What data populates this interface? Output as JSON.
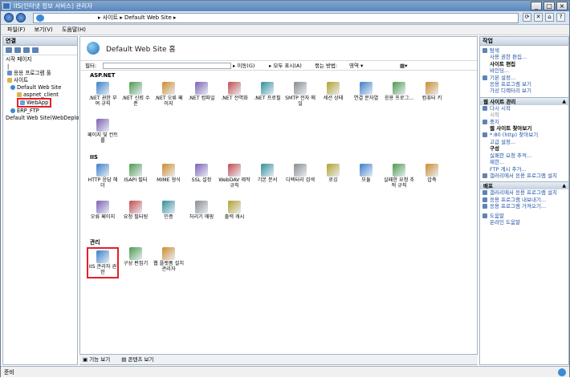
{
  "window": {
    "title": "IIS(인터넷 정보 서비스) 관리자"
  },
  "address": {
    "path": "▸ 사이트 ▸ Default Web Site ▸"
  },
  "menu": [
    "파일(F)",
    "보기(V)",
    "도움말(H)"
  ],
  "connections": {
    "header": "연결",
    "tree": [
      "시작 페이지",
      "|",
      "응용 프로그램 풀",
      "사이트",
      "Default Web Site",
      "aspnet_client",
      "WebApp",
      "ERP_FTP",
      "Default Web Site(WebDeploy)"
    ]
  },
  "center": {
    "title": "Default Web Site 홈",
    "filter": {
      "label": "필터:",
      "go": "이동(G)",
      "show_all": "모두 표시(A)",
      "groupby": "묶는 방법:",
      "groupby_value": "영역"
    },
    "groups": {
      "aspnet": {
        "label": "ASP.NET",
        "items": [
          ".NET 권한 부여 규칙",
          ".NET 신뢰 수준",
          ".NET 오류 페이지",
          ".NET 컴파일",
          ".NET 전역화",
          ".NET 프로필",
          "SMTP 전자 메일",
          "세션 상태",
          "연결 문자열",
          "응용 프로그...",
          "컴퓨터 키",
          "페이지 및 컨트롤"
        ]
      },
      "iis": {
        "label": "IIS",
        "items": [
          "HTTP 응답 헤더",
          "ISAPI 필터",
          "MIME 형식",
          "SSL 설정",
          "WebDAV 제작 규칙",
          "기본 문서",
          "디렉터리 검색",
          "로깅",
          "모듈",
          "실패한 요청 추적 규칙",
          "압축",
          "오류 페이지",
          "요청 필터링",
          "인증",
          "처리기 매핑",
          "출력 캐시"
        ]
      },
      "mgmt": {
        "label": "관리",
        "items": [
          "IIS 관리자 권한",
          "구성 편집기",
          "웹 플랫폼 설치 관리자"
        ]
      }
    }
  },
  "viewbar": {
    "features": "기능 보기",
    "content": "콘텐츠 보기"
  },
  "actions": {
    "header": "작업",
    "top": [
      "탐색",
      "사용 권한 편집..."
    ],
    "site_edit": {
      "label": "사이트 편집",
      "items": [
        "바인딩...",
        "기본 설정...",
        "응용 프로그램 보기",
        "가상 디렉터리 보기"
      ]
    },
    "site_mgmt": {
      "label": "웹 사이트 관리",
      "items": [
        "다시 시작",
        "시작",
        "중지"
      ]
    },
    "browse": {
      "label": "웹 사이트 찾아보기",
      "items": [
        "*:80 (http) 찾아보기",
        "고급 설정..."
      ]
    },
    "config": {
      "label": "구성",
      "items": [
        "실패한 요청 추적...",
        "제한...",
        "FTP 게시 추가...",
        "갤러리에서 응용 프로그램 설치"
      ]
    },
    "deploy": {
      "label": "배포",
      "items": [
        "갤러리에서 응용 프로그램 설치",
        "응용 프로그램 내보내기...",
        "응용 프로그램 가져오기..."
      ]
    },
    "help": [
      "도움말",
      "온라인 도움말"
    ]
  },
  "status": {
    "text": "준비"
  }
}
